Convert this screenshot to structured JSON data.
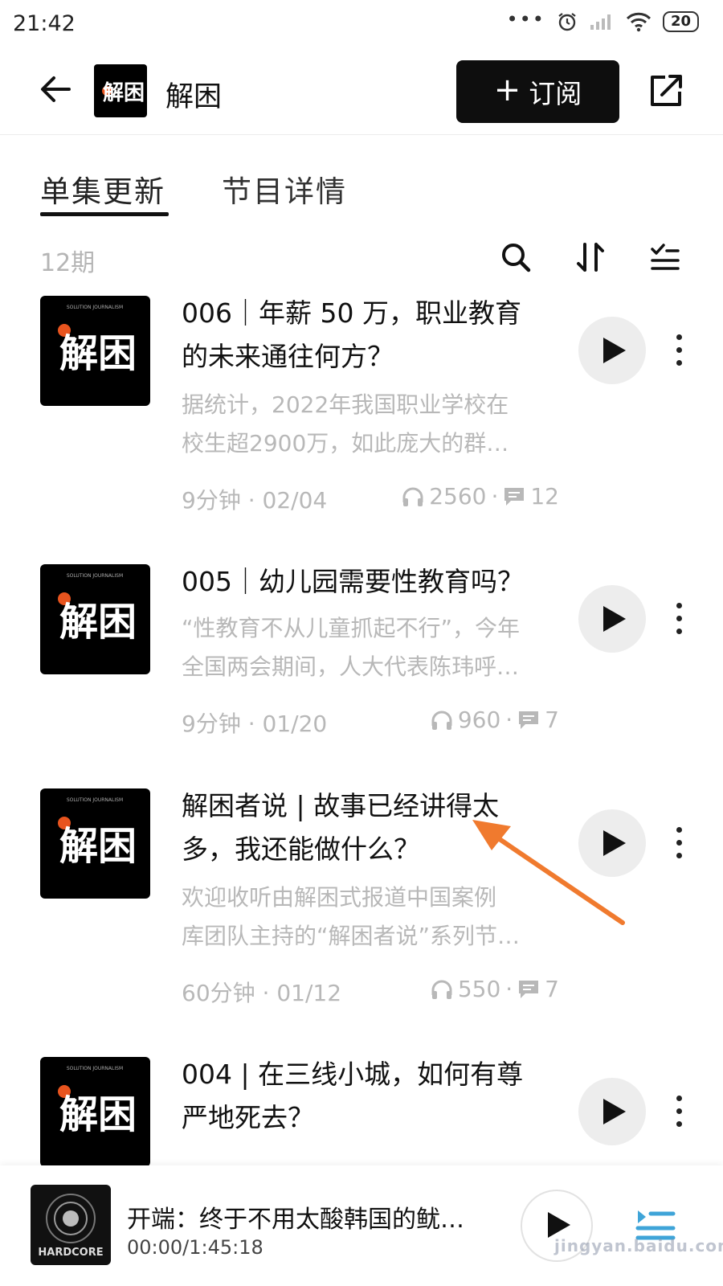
{
  "status_bar": {
    "time": "21:42",
    "dots": "•••",
    "battery": "20"
  },
  "header": {
    "title": "解困",
    "subscribe_label": "订阅",
    "subscribe_plus": "+",
    "logo_text": "解困"
  },
  "tabs": [
    {
      "label": "单集更新",
      "active": true
    },
    {
      "label": "节目详情",
      "active": false
    }
  ],
  "episode_count": "12期",
  "cover": {
    "banner": "SOLUTION JOURNALISM",
    "mark": "解困"
  },
  "episodes": [
    {
      "title": "006｜年薪 50 万，职业教育的未来通往何方？",
      "title_lines": [
        "006｜年薪 50 万，职业教育",
        "的未来通往何方？"
      ],
      "desc_lines": [
        "据统计，2022年我国职业学校在",
        "校生超2900万，如此庞大的群…"
      ],
      "duration_date": "9分钟 · 02/04",
      "plays": "2560",
      "comments": "12"
    },
    {
      "title": "005｜幼儿园需要性教育吗？",
      "title_lines": [
        "005｜幼儿园需要性教育吗？"
      ],
      "desc_lines": [
        "“性教育不从儿童抓起不行”，今年",
        "全国两会期间，人大代表陈玮呼…"
      ],
      "duration_date": "9分钟 · 01/20",
      "plays": "960",
      "comments": "7"
    },
    {
      "title": "解困者说 | 故事已经讲得太多，我还能做什么？",
      "title_lines": [
        "解困者说 | 故事已经讲得太",
        "多，我还能做什么？"
      ],
      "desc_lines": [
        "欢迎收听由解困式报道中国案例",
        "库团队主持的“解困者说”系列节…"
      ],
      "duration_date": "60分钟 · 01/12",
      "plays": "550",
      "comments": "7"
    },
    {
      "title": "004 | 在三线小城，如何有尊严地死去？",
      "title_lines": [
        "004 | 在三线小城，如何有尊",
        "严地死去？"
      ],
      "desc_lines": [],
      "duration_date": "",
      "plays": "",
      "comments": ""
    }
  ],
  "player": {
    "title": "开端：终于不用太酸韩国的鱿…",
    "time": "00:00/1:45:18",
    "cover_text": "HARDCORE"
  },
  "watermark": "jingyan.baidu.com",
  "colors": {
    "accent": "#0e0e0e",
    "muted": "#b8b8b8",
    "arrow": "#f07a2e",
    "cover_dot": "#e8541e"
  }
}
